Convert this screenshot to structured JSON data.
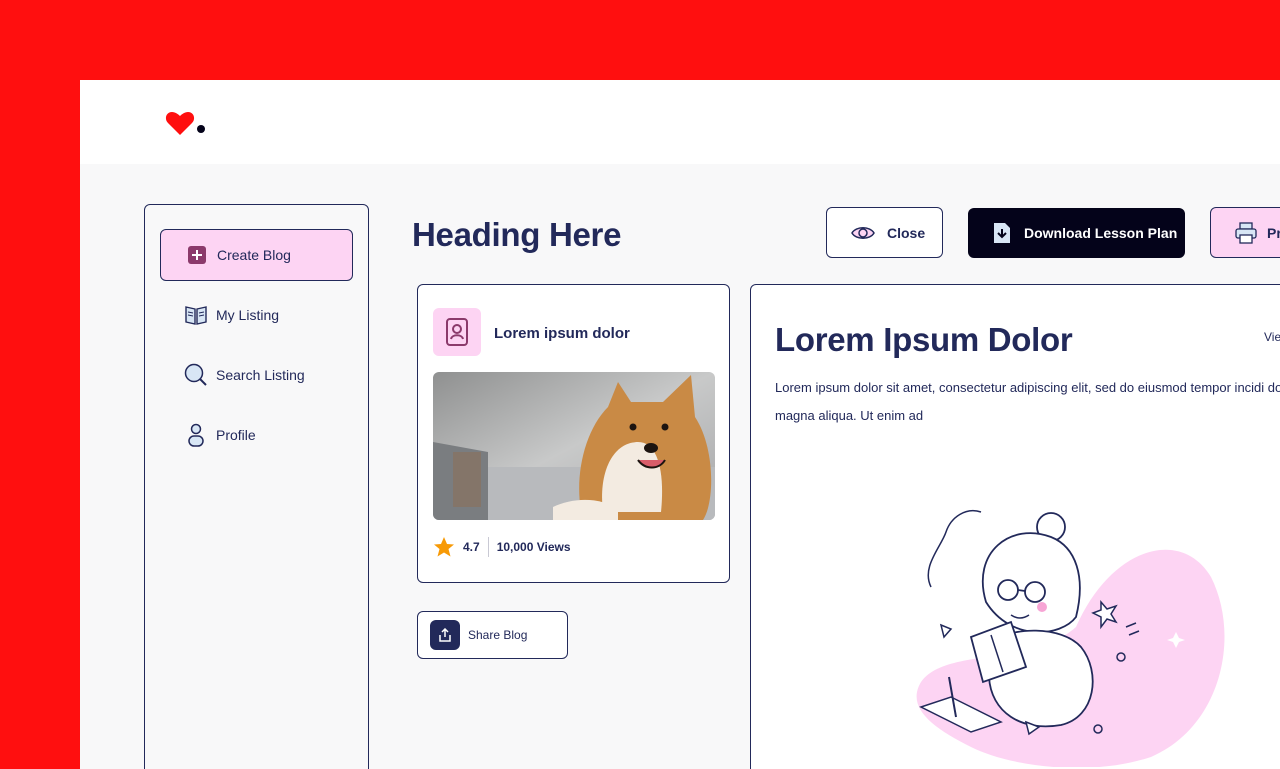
{
  "sidebar": {
    "items": [
      {
        "label": "Create Blog",
        "icon": "plus-square-icon"
      },
      {
        "label": "My Listing",
        "icon": "book-icon"
      },
      {
        "label": "Search Listing",
        "icon": "search-icon"
      },
      {
        "label": "Profile",
        "icon": "user-icon"
      }
    ]
  },
  "main": {
    "heading": "Heading Here"
  },
  "toolbar": {
    "close_label": "Close",
    "download_label": "Download Lesson Plan",
    "print_label": "Pr"
  },
  "card": {
    "title": "Lorem ipsum dolor",
    "rating": "4.7",
    "views": "10,000 Views"
  },
  "share": {
    "label": "Share Blog"
  },
  "detail": {
    "title": "Lorem Ipsum Dolor",
    "link": "Vie",
    "body": "Lorem ipsum dolor sit amet, consectetur adipiscing elit, sed do eiusmod tempor incidi dolore magna aliqua. Ut enim ad"
  },
  "colors": {
    "brand_red": "#ff0f0f",
    "navy": "#22295a",
    "pink": "#fdd4f3",
    "dark": "#04031a",
    "star": "#f79a07"
  }
}
